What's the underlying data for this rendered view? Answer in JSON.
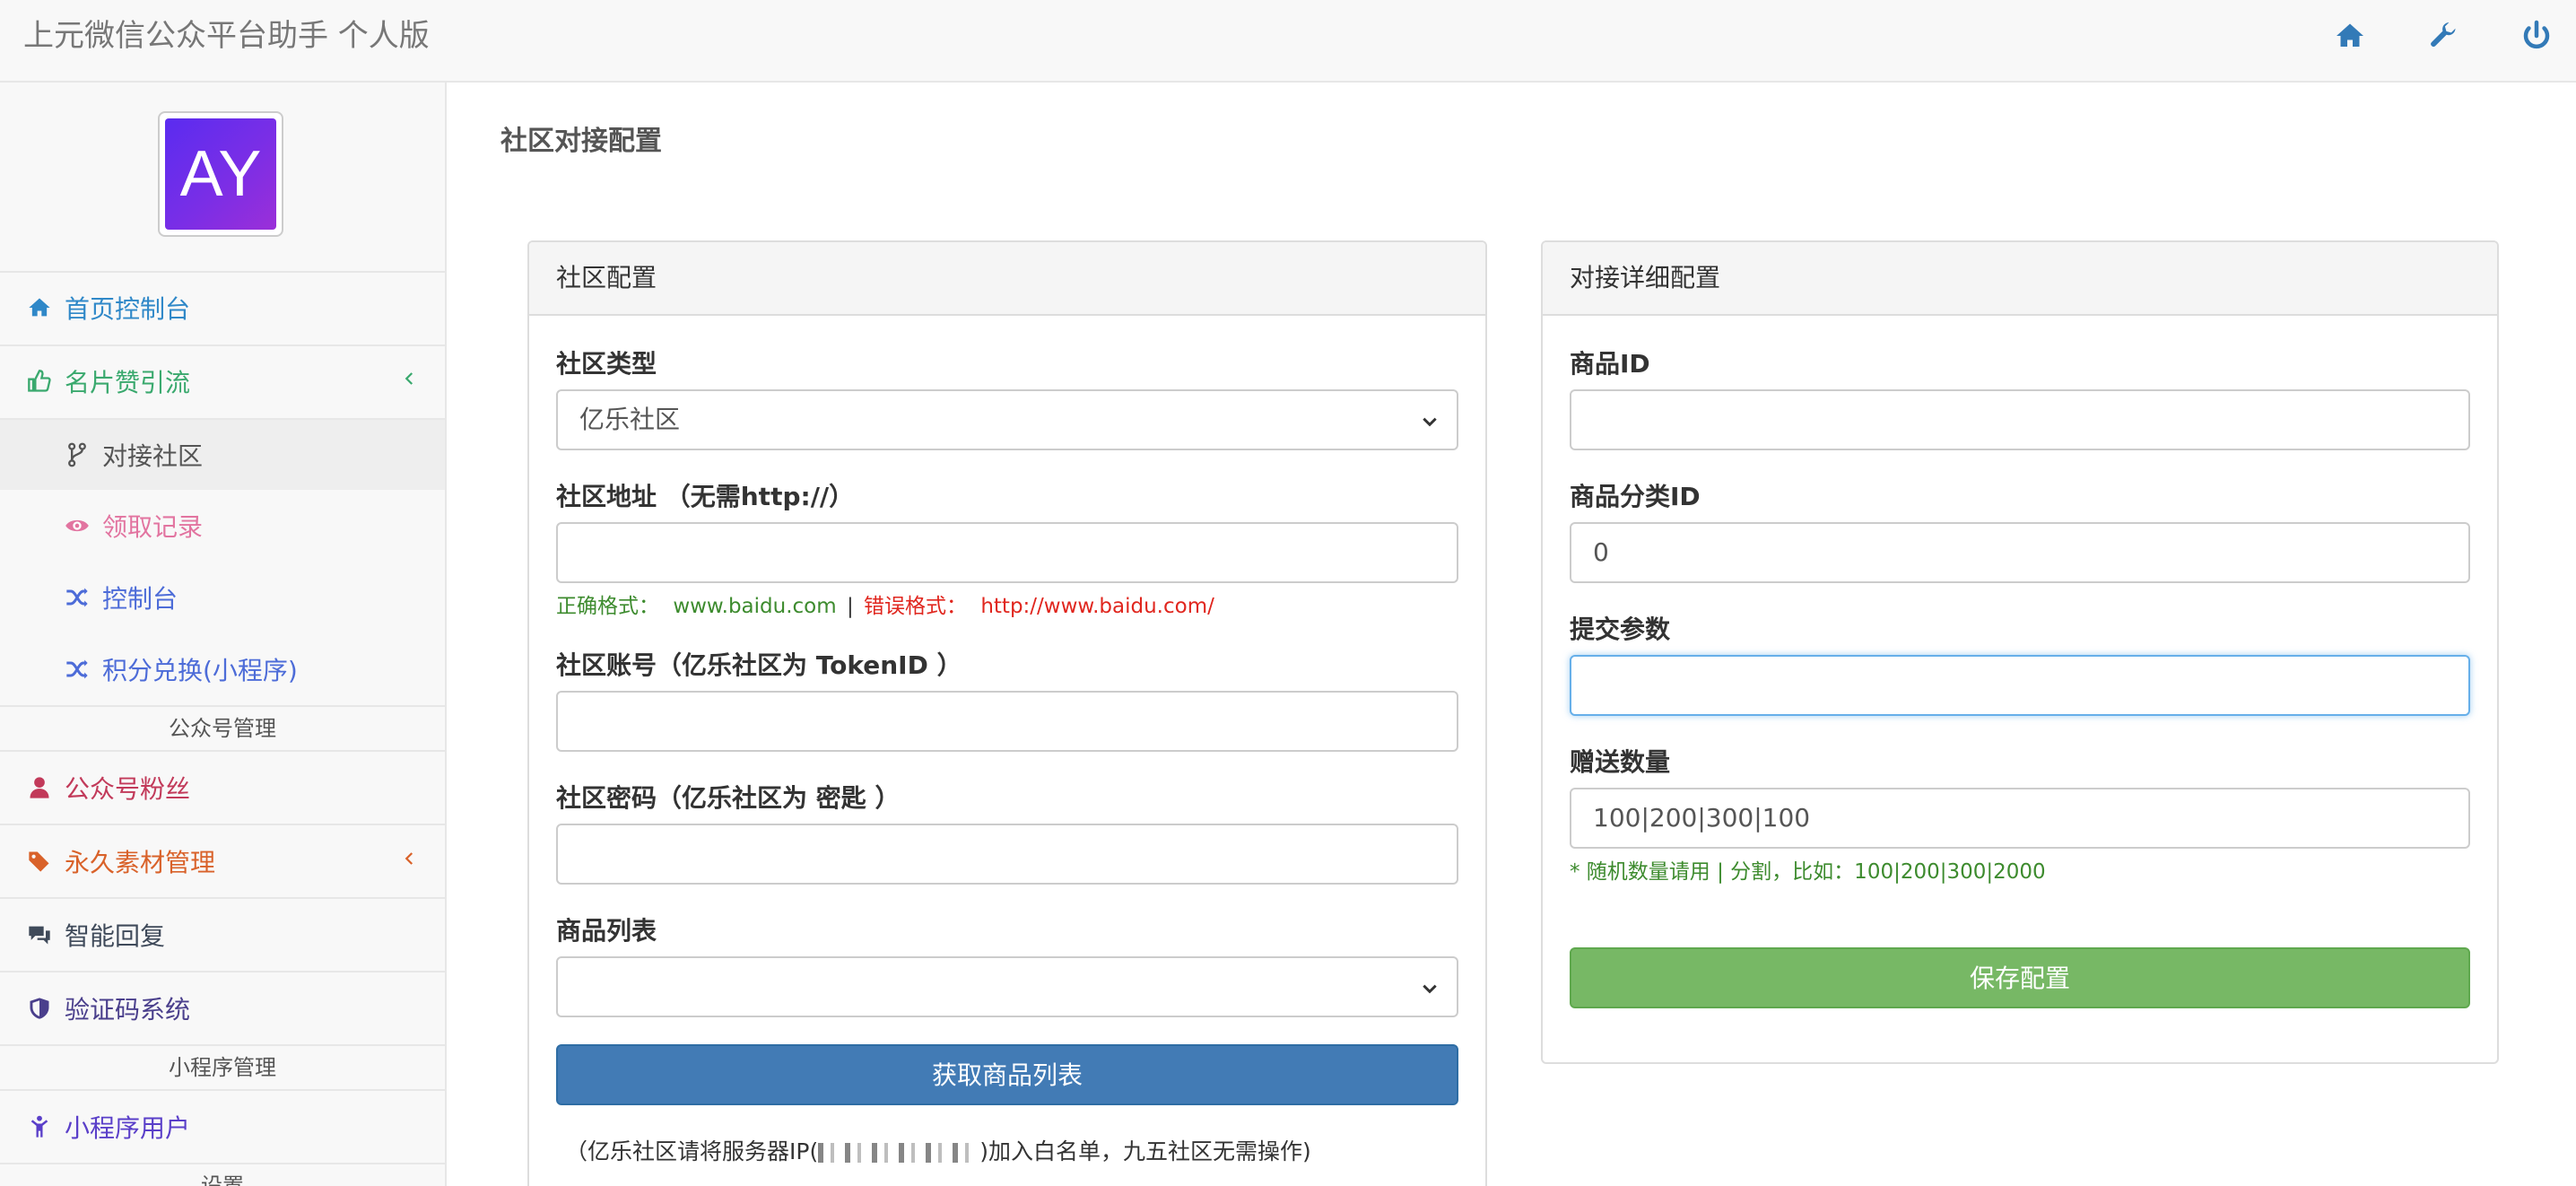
{
  "app": {
    "title": "上元微信公众平台助手 个人版",
    "avatar_text": "AY",
    "colors": {
      "link": "#337ab7",
      "primary_button": "#427bb5",
      "success_button": "#77b865",
      "error_text": "#e0261e",
      "success_text": "#3d8b2e"
    }
  },
  "topbar": {
    "icons": [
      "home-icon",
      "wrench-icon",
      "power-icon"
    ]
  },
  "sidebar": {
    "items": [
      {
        "label": "首页控制台",
        "icon": "home-icon",
        "color": "#2f88c8"
      },
      {
        "label": "名片赞引流",
        "icon": "thumbs-up-icon",
        "color": "#3aa96e"
      },
      {
        "label": "对接社区",
        "icon": "code-fork-icon",
        "color": "#555555"
      },
      {
        "label": "领取记录",
        "icon": "eye-icon",
        "color": "#e274a0"
      },
      {
        "label": "控制台",
        "icon": "random-icon",
        "color": "#4d6cd8"
      },
      {
        "label": "积分兑换(小程序)",
        "icon": "random-icon",
        "color": "#4d6cd8"
      },
      {
        "label": "公众号粉丝",
        "icon": "user-icon",
        "color": "#c23a5a"
      },
      {
        "label": "永久素材管理",
        "icon": "tags-icon",
        "color": "#d9622a"
      },
      {
        "label": "智能回复",
        "icon": "comments-icon",
        "color": "#3f4a5a"
      },
      {
        "label": "验证码系统",
        "icon": "shield-icon",
        "color": "#4a3f8c"
      },
      {
        "label": "小程序用户",
        "icon": "child-icon",
        "color": "#5a3fc9"
      }
    ],
    "sections": [
      "公众号管理",
      "小程序管理",
      "设置"
    ]
  },
  "main": {
    "page_title": "社区对接配置",
    "left_panel": {
      "heading": "社区配置",
      "community_type_label": "社区类型",
      "community_type_value": "亿乐社区",
      "address_label": "社区地址 （无需http://）",
      "address_value": "",
      "hint_correct_label": "正确格式：",
      "hint_correct_value": "www.baidu.com",
      "hint_sep": "|",
      "hint_wrong_label": "错误格式：",
      "hint_wrong_value": "http://www.baidu.com/",
      "account_label": "社区账号（亿乐社区为 TokenID ）",
      "account_value": "",
      "password_label": "社区密码（亿乐社区为 密匙 ）",
      "password_value": "",
      "goods_list_label": "商品列表",
      "goods_list_value": "",
      "fetch_button": "获取商品列表",
      "note_before": "（亿乐社区请将服务器IP(",
      "note_after": ")加入白名单，九五社区无需操作)"
    },
    "right_panel": {
      "heading": "对接详细配置",
      "goods_id_label": "商品ID",
      "goods_id_value": "",
      "category_id_label": "商品分类ID",
      "category_id_value": "0",
      "submit_params_label": "提交参数",
      "submit_params_value": "",
      "gift_qty_label": "赠送数量",
      "gift_qty_value": "100|200|300|100",
      "gift_qty_hint": "* 随机数量请用 | 分割，比如：100|200|300|2000",
      "save_button": "保存配置"
    }
  }
}
